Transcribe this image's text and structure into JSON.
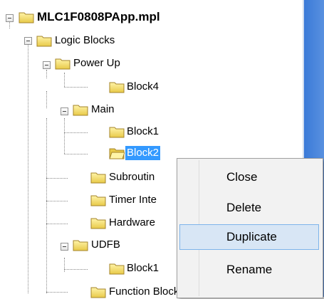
{
  "tree": {
    "root": "MLC1F0808PApp.mpl",
    "logic_blocks": "Logic Blocks",
    "power_up": "Power Up",
    "block4": "Block4",
    "main": "Main",
    "block1": "Block1",
    "block2": "Block2",
    "subroutines": "Subroutin",
    "timer_interrupts": "Timer Inte",
    "hardware": "Hardware",
    "udfb": "UDFB",
    "udfb_block": "Block1",
    "function_block_instance": "Function Block Instance"
  },
  "context_menu": {
    "close": "Close",
    "delete": "Delete",
    "duplicate": "Duplicate",
    "rename": "Rename"
  },
  "colors": {
    "selection": "#3399ff",
    "menu_hover": "#d8e6f5",
    "right_panel": "#3a7ad8"
  }
}
